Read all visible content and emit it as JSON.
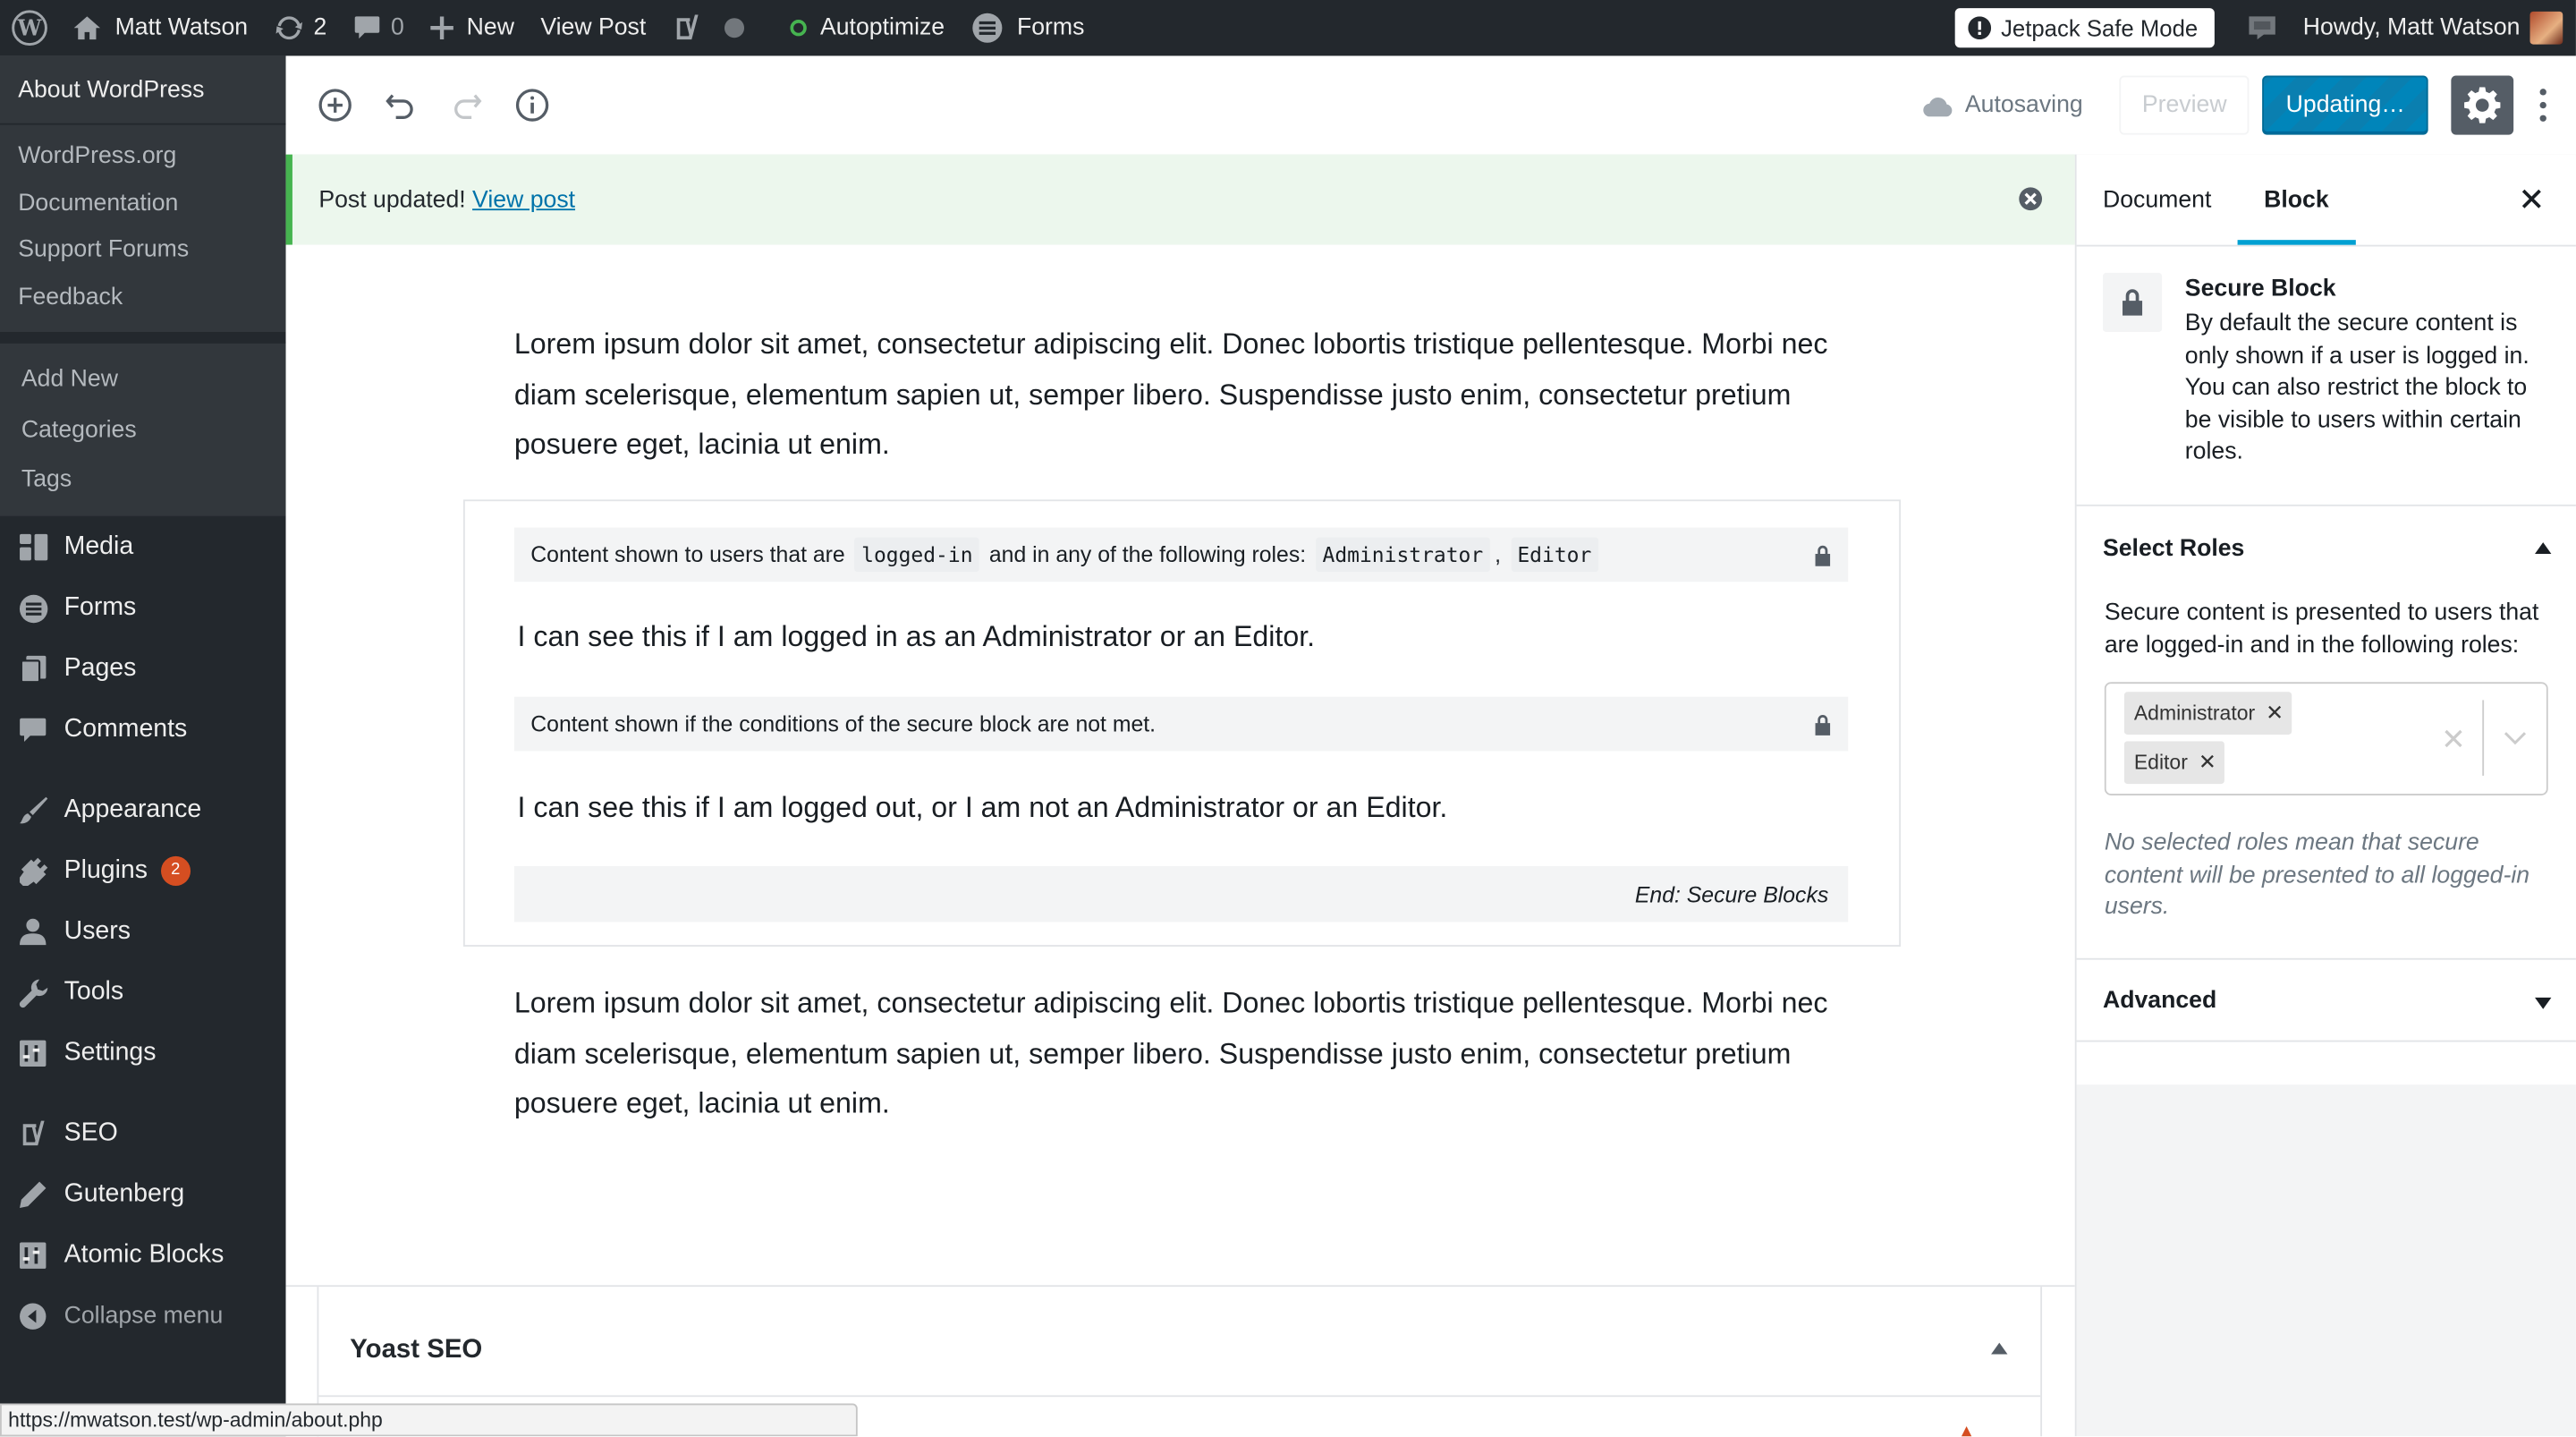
{
  "adminbar": {
    "site_name": "Matt Watson",
    "updates_count": "2",
    "comments_count": "0",
    "new_label": "New",
    "view_post_label": "View Post",
    "autoptimize_label": "Autoptimize",
    "forms_label": "Forms",
    "jetpack_label": "Jetpack Safe Mode",
    "howdy_label": "Howdy, Matt Watson"
  },
  "sidebar": {
    "about_label": "About WordPress",
    "wp_links": [
      "WordPress.org",
      "Documentation",
      "Support Forums",
      "Feedback"
    ],
    "posts_submenu": [
      "Add New",
      "Categories",
      "Tags"
    ],
    "menu": {
      "media": "Media",
      "forms": "Forms",
      "pages": "Pages",
      "comments": "Comments",
      "appearance": "Appearance",
      "plugins": "Plugins",
      "plugins_badge": "2",
      "users": "Users",
      "tools": "Tools",
      "settings": "Settings",
      "seo": "SEO",
      "gutenberg": "Gutenberg",
      "atomic_blocks": "Atomic Blocks",
      "collapse": "Collapse menu"
    }
  },
  "header": {
    "autosaving_label": "Autosaving",
    "preview_label": "Preview",
    "updating_label": "Updating…"
  },
  "notice": {
    "text": "Post updated!",
    "link_label": "View post"
  },
  "content": {
    "paragraph_top": "Lorem ipsum dolor sit amet, consectetur adipiscing elit. Donec lobortis tristique pellentesque. Morbi nec diam scelerisque, elementum sapien ut, semper libero. Suspendisse justo enim, consectetur pretium posuere eget, lacinia ut enim.",
    "secure": {
      "bar_prefix": "Content shown to users that are",
      "bar_code_logged": "logged-in",
      "bar_middle": "and in any of the following roles:",
      "role_admin": "Administrator",
      "role_sep": ",",
      "role_editor": "Editor",
      "allowed_text": "I can see this if I am logged in as an Administrator or an Editor.",
      "fallback_bar": "Content shown if the conditions of the secure block are not met.",
      "fallback_text": "I can see this if I am logged out, or I am not an Administrator or an Editor.",
      "end_label": "End: Secure Blocks"
    },
    "paragraph_bottom": "Lorem ipsum dolor sit amet, consectetur adipiscing elit. Donec lobortis tristique pellentesque. Morbi nec diam scelerisque, elementum sapien ut, semper libero. Suspendisse justo enim, consectetur pretium posuere eget, lacinia ut enim."
  },
  "yoast": {
    "title": "Yoast SEO"
  },
  "statusbar": {
    "url": "https://mwatson.test/wp-admin/about.php"
  },
  "inspector": {
    "tab_document": "Document",
    "tab_block": "Block",
    "block_title": "Secure Block",
    "block_description": "By default the secure content is only shown if a user is logged in. You can also restrict the block to be visible to users within certain roles.",
    "select_roles_title": "Select Roles",
    "select_roles_intro": "Secure content is presented to users that are logged-in and in the following roles:",
    "selected_roles": [
      "Administrator",
      "Editor"
    ],
    "roles_help": "No selected roles mean that secure content will be presented to all logged-in users.",
    "advanced_title": "Advanced"
  },
  "colors": {
    "admin_bg": "#23282d",
    "accent_blue": "#0085ba",
    "notice_green": "#46b450",
    "tab_underline": "#00a0d2",
    "badge": "#d54e21"
  }
}
